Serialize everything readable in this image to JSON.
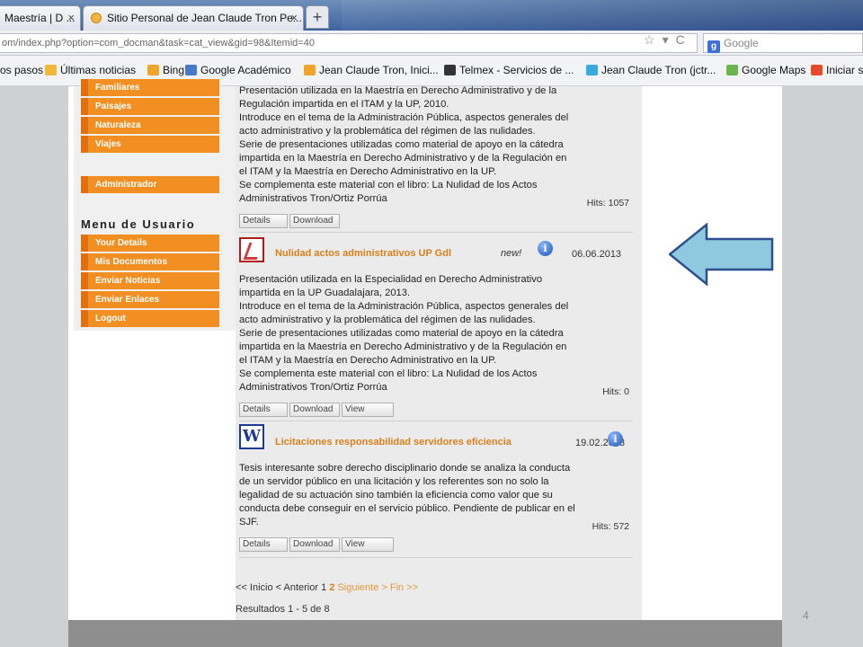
{
  "browser": {
    "tabs": [
      {
        "label": "Maestría | D ..."
      },
      {
        "label": "Sitio Personal de Jean Claude Tron Pe..."
      }
    ],
    "new_tab": "+",
    "close_glyph": "×",
    "url": "om/index.php?option=com_docman&task=cat_view&gid=98&Itemid=40",
    "search_placeholder": "Google",
    "bookmarks": [
      {
        "label": "os pasos",
        "color": "#f0b73a"
      },
      {
        "label": "Últimas noticias",
        "color": "#f0b73a"
      },
      {
        "label": "Bing",
        "color": "#f0a52a"
      },
      {
        "label": "Google Académico",
        "color": "#4a78c8"
      },
      {
        "label": "Jean Claude Tron, Inici...",
        "color": "#f0a52a"
      },
      {
        "label": "Telmex - Servicios de ...",
        "color": "#333333"
      },
      {
        "label": "Jean Claude Tron (jctr...",
        "color": "#39a9e0"
      },
      {
        "label": "Google Maps",
        "color": "#6bb34a"
      },
      {
        "label": "Iniciar s",
        "color": "#e64a2a"
      }
    ]
  },
  "sidebar": {
    "top_items": [
      "Familiares",
      "Paisajes",
      "Naturaleza",
      "Viajes"
    ],
    "admin_item": "Administrador",
    "user_menu_title": "Menu de Usuario",
    "user_items": [
      "Your Details",
      "Mis Documentos",
      "Enviar Noticias",
      "Enviar Enlaces",
      "Logout"
    ]
  },
  "docs": [
    {
      "lines": [
        "Presentación utilizada en la Maestría en Derecho Administrativo y de la",
        "Regulación impartida en el ITAM y la UP, 2010.",
        "Introduce en el tema de la Administración Pública, aspectos generales del",
        "acto administrativo y la problemática del régimen de las nulidades.",
        "Serie de presentaciones utilizadas como material de apoyo en la cátedra",
        "impartida en la Maestría en Derecho Administrativo y de la Regulación en",
        "el ITAM y la Maestría en Derecho Administrativo en la UP.",
        "Se complementa este material con el libro: La Nulidad de los Actos",
        "Administrativos Tron/Ortiz Porrúa"
      ],
      "hits": "Hits: 1057",
      "buttons": [
        "Details",
        "Download"
      ]
    },
    {
      "title": "Nulidad actos administrativos UP Gdl",
      "new": "new!",
      "date": "06.06.2013",
      "lines": [
        "Presentación utilizada en la Especialidad en Derecho Administrativo",
        "impartida en  la UP Guadalajara, 2013.",
        "Introduce en el tema de la Administración Pública, aspectos generales del",
        "acto administrativo y la problemática del régimen de las nulidades.",
        "Serie de presentaciones utilizadas como material de apoyo en la cátedra",
        "impartida en la Maestría en Derecho Administrativo y de la Regulación en",
        "el ITAM y la Maestría en Derecho Administrativo en la UP.",
        "Se complementa este material con el libro: La Nulidad de los Actos",
        "Administrativos Tron/Ortiz Porrúa"
      ],
      "hits": "Hits: 0",
      "buttons": [
        "Details",
        "Download",
        "View"
      ]
    },
    {
      "title": "Licitaciones responsabilidad servidores eficiencia",
      "date": "19.02.2013",
      "lines": [
        "Tesis interesante sobre derecho disciplinario donde se analiza la conducta",
        "de un servidor público en una licitación y los referentes son no solo la",
        "legalidad de su actuación sino también la eficiencia como valor que su",
        "conducta debe conseguir en el servicio público. Pendiente de publicar en el",
        "SJF."
      ],
      "hits": "Hits: 572",
      "buttons": [
        "Details",
        "Download",
        "View"
      ]
    }
  ],
  "info_glyph": "i",
  "pager": {
    "prefix": "<< Inicio < Anterior 1 ",
    "current": "2",
    "suffix": " Siguiente > Fin >>"
  },
  "results": "Resultados 1 - 5 de 8",
  "slide_number": "4",
  "colors": {
    "accent_orange": "#f18f22",
    "arrow_fill": "#8ec9df",
    "arrow_stroke": "#2c4f8e"
  }
}
